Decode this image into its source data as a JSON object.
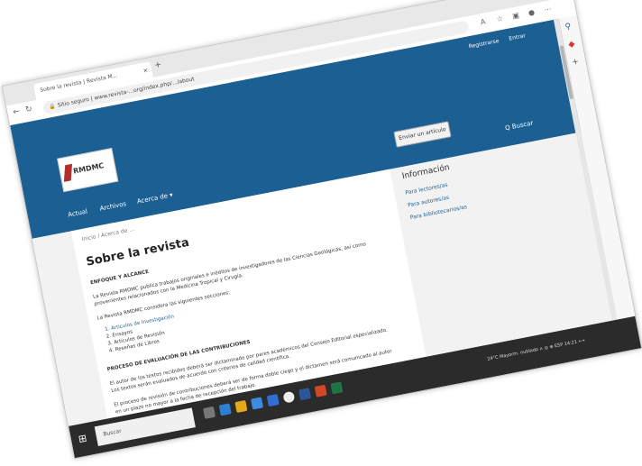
{
  "browser": {
    "tab_title": "Sobre la revista | Revista M...",
    "tab_close": "×",
    "new_tab": "+",
    "url": "Sitio seguro | www.revista-...org/index.php/.../about",
    "win_minimize": "–",
    "win_maximize": "□",
    "win_close": "×"
  },
  "header": {
    "register": "Registrarse",
    "login": "Entrar",
    "logo_text": "RMDMC",
    "menu": [
      "Actual",
      "Archivos",
      "Acerca de ▾"
    ],
    "search": "Q Buscar",
    "submit_button": "Enviar un artículo"
  },
  "main": {
    "breadcrumb": "Inicio / Acerca de ...",
    "title": "Sobre la revista",
    "section1": "ENFOQUE Y ALCANCE",
    "p1a": "La Revista RMDMC publica trabajos originales e inéditos de investigadores de las Ciencias Geológicas, así como",
    "p1b": "provenientes relacionados con la Medicina Tropical y Cirugía.",
    "p2": "La Revista RMDMC considera las siguientes secciones:",
    "list": [
      "1. Artículos de Investigación",
      "2. Ensayos",
      "3. Artículos de Revisión",
      "4. Reseñas de Libros"
    ],
    "section2": "PROCESO DE EVALUACIÓN DE LAS CONTRIBUCIONES",
    "p3a": "El autor de los textos recibidos deberá ser dictaminado por pares académicos del Consejo Editorial especializado.",
    "p3b": "Los textos serán evaluados de acuerdo con criterios de calidad científica.",
    "p4a": "El proceso de revisión de contribuciones deberá ser de forma doble ciego y el dictamen será comunicado al autor",
    "p4b": "en un plazo no mayor a la fecha de recepción del trabajo."
  },
  "sidebar": {
    "title": "Información",
    "links": [
      "Para lectores/as",
      "Para autores/as",
      "Para bibliotecarios/as"
    ]
  },
  "taskbar": {
    "start": "⊞",
    "search_placeholder": "Buscar",
    "tray": "24°C Mayorm. nublado ∧ ◎ ⊕ ESP 14:21 ⟷"
  }
}
